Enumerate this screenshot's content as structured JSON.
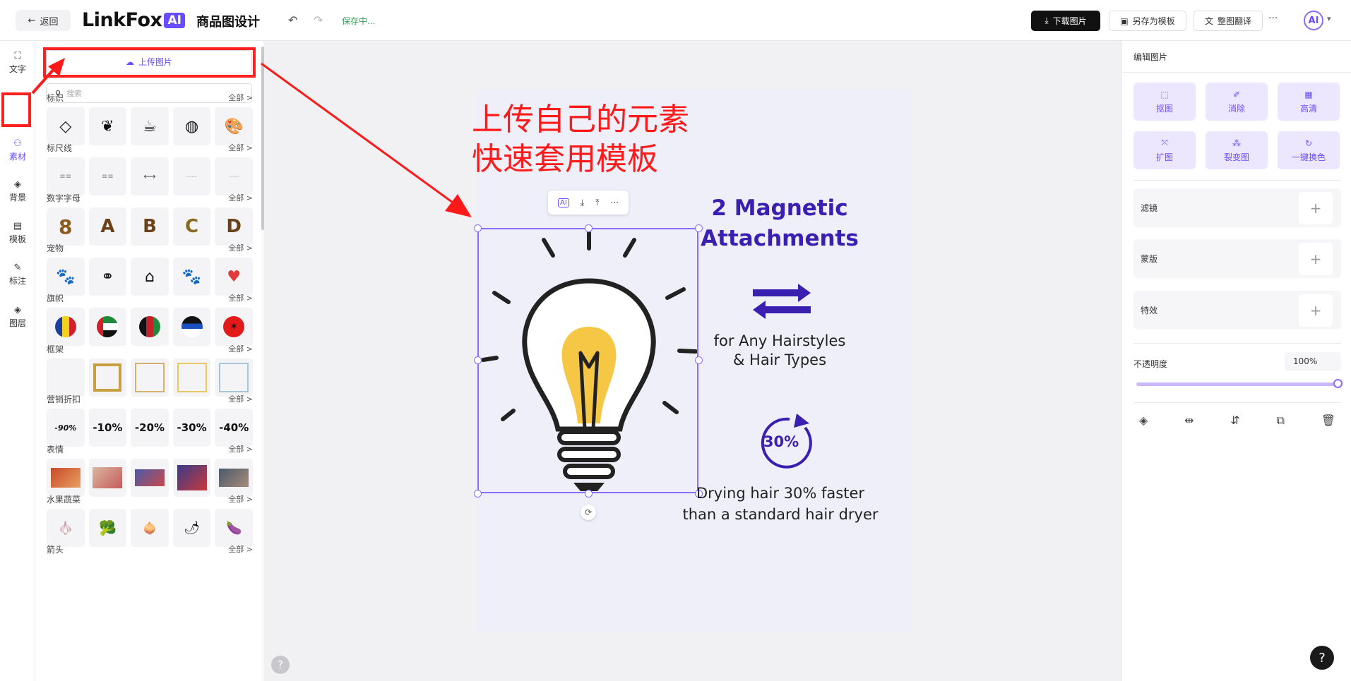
{
  "topbar": {
    "back_label": "返回",
    "logo_text": "LinkFox",
    "logo_badge": "AI",
    "page_title": "商品图设计",
    "save_status": "保存中...",
    "download_label": "下载图片",
    "save_template_label": "另存为模板",
    "translate_label": "整图翻译",
    "more_label": "···",
    "avatar_text": "AI"
  },
  "rail": {
    "items": [
      {
        "label": "文字",
        "icon": "text-icon"
      },
      {
        "label": "素材",
        "icon": "materials-icon"
      },
      {
        "label": "背景",
        "icon": "background-icon"
      },
      {
        "label": "模板",
        "icon": "template-icon"
      },
      {
        "label": "标注",
        "icon": "annotation-icon"
      },
      {
        "label": "图层",
        "icon": "layers-icon"
      }
    ],
    "active": "素材"
  },
  "panel": {
    "upload_label": "上传图片",
    "search_placeholder": "搜索",
    "all_label": "全部 >",
    "sections": [
      {
        "title": "标识",
        "items": [
          "diamond",
          "leaf",
          "cup",
          "wave",
          "palette"
        ]
      },
      {
        "title": "标尺线",
        "items": [
          "lines-1",
          "lines-2",
          "arrow-line",
          "dot-line",
          "thin-line"
        ]
      },
      {
        "title": "数字字母",
        "items": [
          "8",
          "A",
          "B",
          "C",
          "D"
        ]
      },
      {
        "title": "宠物",
        "items": [
          "paw",
          "dog-bone",
          "pet-house",
          "paw-large",
          "heart-paw"
        ]
      },
      {
        "title": "旗帜",
        "items": [
          "andorra",
          "uae",
          "afghanistan",
          "antigua",
          "albania"
        ]
      },
      {
        "title": "框架",
        "items": [
          "frame-blank",
          "frame-gold",
          "frame-thin",
          "frame-yellow",
          "frame-blue"
        ]
      },
      {
        "title": "营销折扣",
        "items": [
          "-90%",
          "-10%",
          "-20%",
          "-30%",
          "-40%"
        ]
      },
      {
        "title": "表情",
        "items": [
          "meme-1",
          "meme-2",
          "meme-3",
          "meme-4",
          "meme-5"
        ]
      },
      {
        "title": "水果蔬菜",
        "items": [
          "garlic",
          "broccoli",
          "onion",
          "chili",
          "eggplant"
        ]
      },
      {
        "title": "箭头",
        "items": []
      }
    ]
  },
  "canvas": {
    "annotation_line1": "上传自己的元素",
    "annotation_line2": "快速套用模板",
    "heading_line1": "2 Magnetic",
    "heading_line2": "Attachments",
    "copy1_line1": "for Any Hairstyles",
    "copy1_line2": "& Hair Types",
    "badge": "30%",
    "copy2_line1": "Drying hair 30% faster",
    "copy2_line2": "than a standard hair dryer",
    "toolbar_more": "···"
  },
  "right_panel": {
    "title": "编辑图片",
    "tools": [
      {
        "label": "抠图",
        "icon": "cutout-icon"
      },
      {
        "label": "消除",
        "icon": "erase-icon"
      },
      {
        "label": "高清",
        "icon": "hd-icon"
      },
      {
        "label": "扩图",
        "icon": "expand-icon"
      },
      {
        "label": "裂变图",
        "icon": "fission-icon"
      },
      {
        "label": "一键换色",
        "icon": "recolor-icon"
      }
    ],
    "filter_label": "滤镜",
    "mask_label": "蒙版",
    "effects_label": "特效",
    "opacity_label": "不透明度",
    "opacity_value": "100%",
    "opacity": 1.0
  },
  "colors": {
    "accent": "#6a4cff",
    "annotation_red": "#ff1a1a",
    "heading_blue": "#3a1fb0"
  }
}
